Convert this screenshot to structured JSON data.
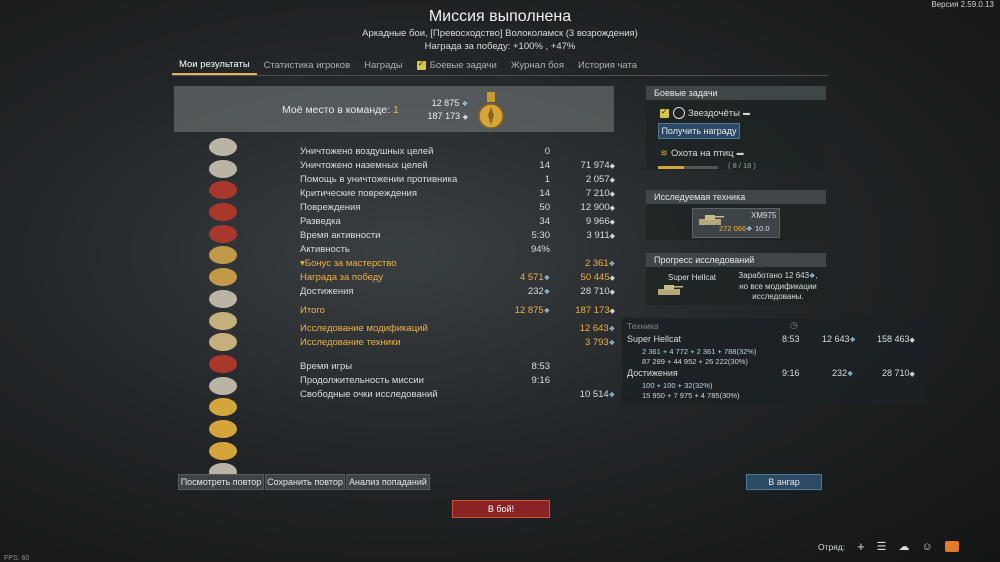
{
  "version": "Версия 2.59.0.13",
  "title": "Миссия выполнена",
  "subtitle": "Аркадные бои, [Превосходство] Волоколамск (3 возрождения)",
  "reward_line": "Награда за победу: +100% , +47%",
  "tabs": [
    {
      "label": "Мои результаты",
      "active": true
    },
    {
      "label": "Статистика игроков"
    },
    {
      "label": "Награды"
    },
    {
      "label": "Боевые задачи"
    },
    {
      "label": "Журнал боя"
    },
    {
      "label": "История чата"
    }
  ],
  "place": {
    "label": "Моё место в команде:",
    "value": "1",
    "rp": "12 875",
    "sl": "187 173"
  },
  "stats": [
    {
      "label": "Уничтожено воздушных целей",
      "c1": "0",
      "c2": ""
    },
    {
      "label": "Уничтожено наземных целей",
      "c1": "14",
      "c2": "71 974"
    },
    {
      "label": "Помощь в уничтожении противника",
      "c1": "1",
      "c2": "2 057"
    },
    {
      "label": "Критические повреждения",
      "c1": "14",
      "c2": "7 210"
    },
    {
      "label": "Повреждения",
      "c1": "50",
      "c2": "12 900"
    },
    {
      "label": "Разведка",
      "c1": "34",
      "c2": "9 966"
    },
    {
      "label": "Время активности",
      "c1": "5:30",
      "c2": "3 911"
    },
    {
      "label": "Активность",
      "c1": "94%",
      "c2": ""
    },
    {
      "label": "Бонус за мастерство",
      "c1": "",
      "c2": "2 361"
    },
    {
      "label": "Награда за победу",
      "c1": "4 571",
      "c2": "50 445"
    },
    {
      "label": "Достижения",
      "c1": "232",
      "c2": "28 710"
    },
    {
      "label": "Итого",
      "c1": "12 875",
      "c2": "187 173"
    },
    {
      "label": "Исследование модификаций",
      "c1": "",
      "c2": "12 643"
    },
    {
      "label": "Исследование техники",
      "c1": "",
      "c2": "3 793"
    },
    {
      "label": "Время игры",
      "c1": "8:53",
      "c2": ""
    },
    {
      "label": "Продолжительность миссии",
      "c1": "9:16",
      "c2": ""
    },
    {
      "label": "Свободные очки исследований",
      "c1": "",
      "c2": "10 514"
    }
  ],
  "tasks_panel": {
    "header": "Боевые задачи",
    "task1": "Звездочёты",
    "get_reward": "Получить награду",
    "task2": "Охота на птиц",
    "task2_progress": "( 8 / 18 )",
    "task2_fraction": 0.44
  },
  "research_vehicle_panel": {
    "header": "Исследуемая техника",
    "vehicle": "XM975",
    "rp": "272 066",
    "br": "10.0"
  },
  "progress_panel": {
    "header": "Прогресс исследований",
    "vehicle": "Super Hellcat",
    "text1": "Заработано 12 643",
    "text2": "но все модификации",
    "text3": "исследованы."
  },
  "vehicle_table": {
    "header": "Техника",
    "rows": [
      {
        "name": "Super Hellcat",
        "time": "8:53",
        "rp": "12 643",
        "sl": "158 463",
        "line1": "2 361 + 4 772 + 2 361 + 788(32%)",
        "line2": "87 289 + 44 952 + 26 222(30%)"
      },
      {
        "name": "Достижения",
        "time": "9:16",
        "rp": "232",
        "sl": "28 710",
        "line1": "100 + 100 + 32(32%)",
        "line2": "15 950 + 7 975 + 4 785(30%)"
      }
    ]
  },
  "buttons": {
    "replay": "Посмотреть повтор",
    "save_replay": "Сохранить повтор",
    "hit_analysis": "Анализ попаданий",
    "hangar": "В ангар",
    "battle": "В бой!"
  },
  "squad_label": "Отряд:",
  "fps": "FPS: 60",
  "colors": {
    "accent": "#f0b040",
    "research": "#8ac6e8",
    "battle_button": "#8a2424"
  }
}
